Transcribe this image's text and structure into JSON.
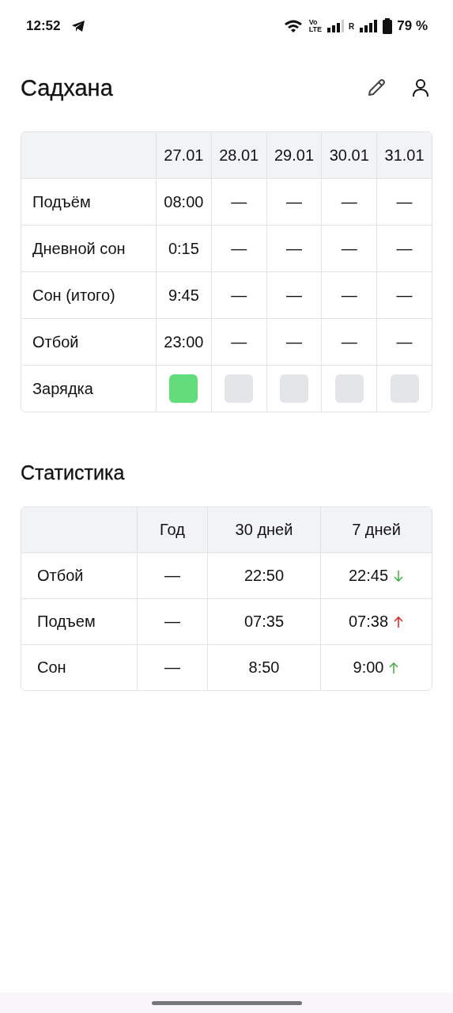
{
  "status_bar": {
    "time": "12:52",
    "volte": [
      "Vo",
      "LTE"
    ],
    "roaming": "R",
    "battery": "79 %"
  },
  "header": {
    "title": "Садхана"
  },
  "daily_table": {
    "columns": [
      "27.01",
      "28.01",
      "29.01",
      "30.01",
      "31.01"
    ],
    "rows": [
      {
        "kind": "text",
        "label": "Подъём",
        "values": [
          "08:00",
          "—",
          "—",
          "—",
          "—"
        ]
      },
      {
        "kind": "text",
        "label": "Дневной сон",
        "values": [
          "0:15",
          "—",
          "—",
          "—",
          "—"
        ]
      },
      {
        "kind": "text",
        "label": "Сон (итого)",
        "values": [
          "9:45",
          "—",
          "—",
          "—",
          "—"
        ]
      },
      {
        "kind": "text",
        "label": "Отбой",
        "values": [
          "23:00",
          "—",
          "—",
          "—",
          "—"
        ]
      },
      {
        "kind": "check",
        "label": "Зарядка",
        "checks": [
          true,
          false,
          false,
          false,
          false
        ]
      }
    ]
  },
  "stats": {
    "title": "Статистика",
    "columns": [
      "Год",
      "30 дней",
      "7 дней"
    ],
    "rows": [
      {
        "label": "Отбой",
        "year": "—",
        "days30": "22:50",
        "days7": "22:45",
        "trend": {
          "rising": false,
          "color": "#4caf50"
        }
      },
      {
        "label": "Подъем",
        "year": "—",
        "days30": "07:35",
        "days7": "07:38",
        "trend": {
          "rising": true,
          "color": "#d32f2f"
        }
      },
      {
        "label": "Сон",
        "year": "—",
        "days30": "8:50",
        "days7": "9:00",
        "trend": {
          "rising": true,
          "color": "#4caf50"
        }
      }
    ]
  }
}
